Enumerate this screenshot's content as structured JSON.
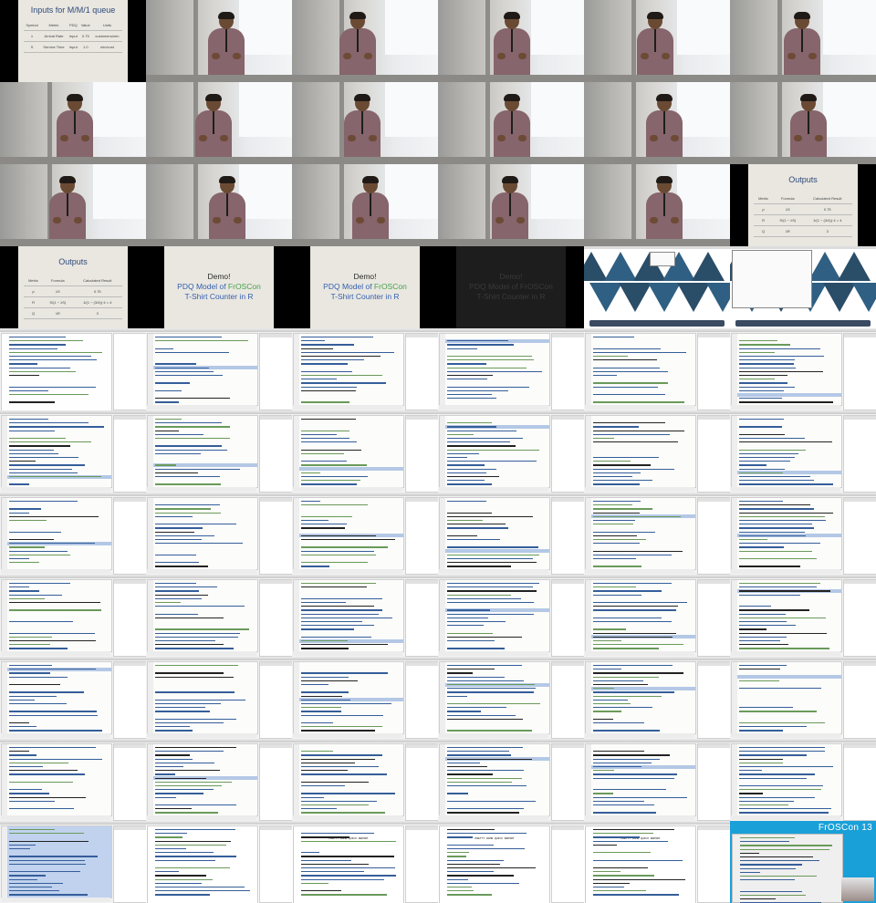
{
  "slide_inputs": {
    "title": "Inputs for M/M/1 queue",
    "headers": [
      "Symbol",
      "Metric",
      "PDQ",
      "Value",
      "Units"
    ],
    "rows": [
      [
        "λ",
        "Arrival Rate",
        "Input",
        "0.75",
        "customers/min"
      ],
      [
        "S",
        "Service Time",
        "Input",
        "1.0",
        "min/cust"
      ]
    ]
  },
  "slide_outputs": {
    "title": "Outputs",
    "headers": [
      "Metric",
      "Formula",
      "Calculated Result"
    ],
    "rows": [
      [
        "ρ",
        "λS",
        "0.75"
      ],
      [
        "R",
        "S/(1 − λS)",
        "1/(1 − (3/4))·4 = 4"
      ],
      [
        "Q",
        "λR",
        "3"
      ]
    ]
  },
  "slide_demo": {
    "line1": "Demo!",
    "line2_a": "PDQ Model of ",
    "line2_b": "FrOSCon",
    "line3": "T-Shirt Counter in R"
  },
  "report": {
    "title": "PRETTY DAMN QUICK REPORT"
  },
  "froscon": {
    "logo": "FrOSCon 13"
  },
  "colors": {
    "slide_bg": "#e9e7e0",
    "slide_title": "#2f4a7a",
    "froscon_blue": "#1aa0d8",
    "ide_highlight": "#b4c8e6"
  },
  "frames": [
    "slide-inputs",
    "video",
    "video",
    "video",
    "video",
    "video",
    "video",
    "video",
    "video",
    "video",
    "video",
    "video",
    "video",
    "video",
    "video",
    "video",
    "video",
    "slide-outputs",
    "slide-outputs",
    "slide-demo",
    "slide-demo",
    "slide-demo-dim",
    "desktop-map",
    "desktop-map-window",
    "ide-console",
    "ide",
    "ide",
    "ide",
    "ide",
    "ide",
    "ide",
    "ide",
    "ide",
    "ide",
    "ide",
    "ide",
    "ide",
    "ide",
    "ide",
    "ide",
    "ide",
    "ide",
    "ide",
    "ide",
    "ide",
    "ide",
    "ide",
    "ide",
    "ide",
    "ide",
    "ide",
    "ide",
    "ide",
    "ide",
    "ide",
    "ide",
    "ide",
    "ide",
    "ide",
    "ide",
    "ide-selected",
    "report-stats",
    "report",
    "report",
    "report",
    "froscon"
  ]
}
